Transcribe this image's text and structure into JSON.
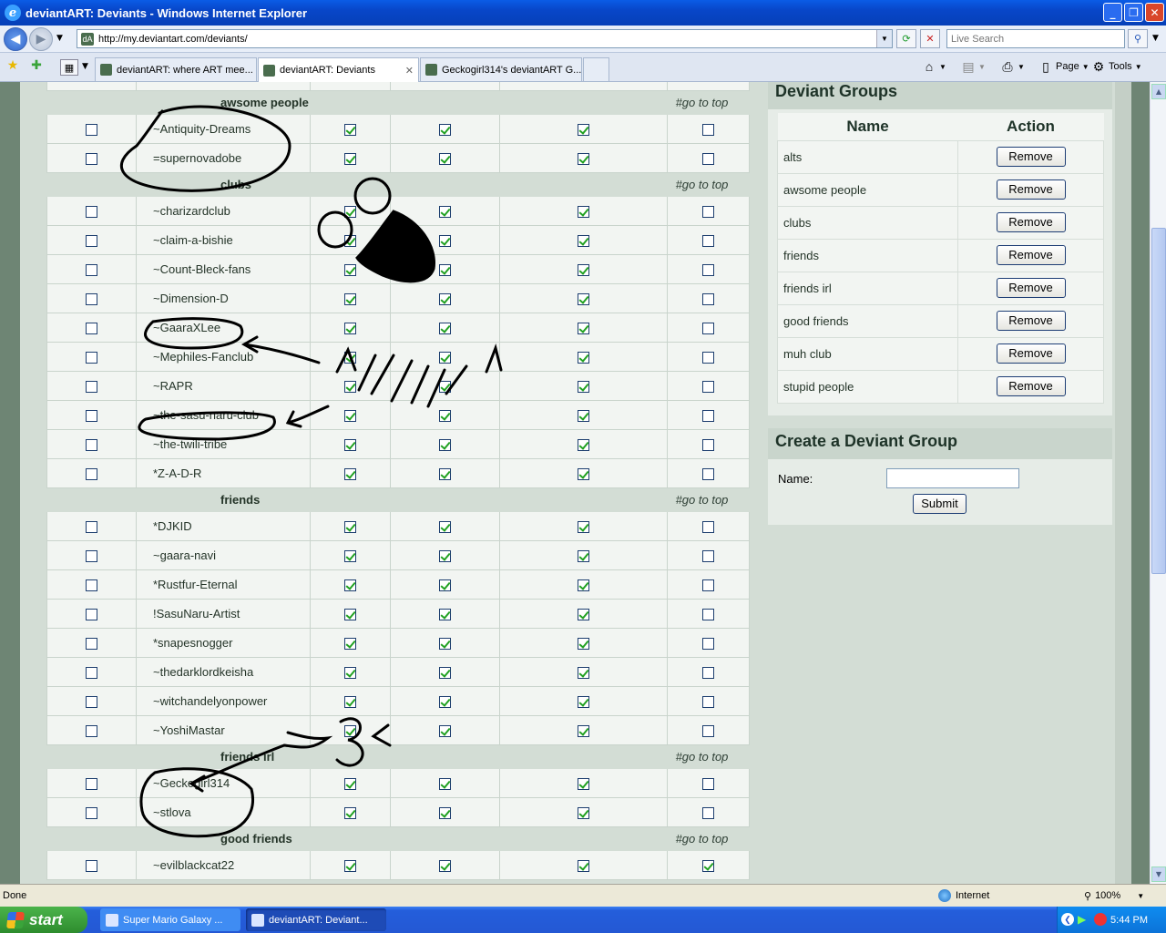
{
  "window": {
    "title": "deviantART: Deviants - Windows Internet Explorer"
  },
  "nav": {
    "url": "http://my.deviantart.com/deviants/",
    "search_placeholder": "Live Search"
  },
  "tabs": [
    {
      "label": "deviantART: where ART mee...",
      "active": false
    },
    {
      "label": "deviantART: Deviants",
      "active": true
    },
    {
      "label": "Geckogirl314's deviantART G...",
      "active": false
    }
  ],
  "toolbar": {
    "page": "Page",
    "tools": "Tools"
  },
  "go_to_top": "#go to top",
  "deviant_groups": [
    {
      "group": "awsome people",
      "members": [
        {
          "name": "~Antiquity-Dreams",
          "checks": [
            true,
            true,
            true,
            false
          ]
        },
        {
          "name": "=supernovadobe",
          "checks": [
            true,
            true,
            true,
            false
          ]
        }
      ]
    },
    {
      "group": "clubs",
      "members": [
        {
          "name": "~charizardclub",
          "checks": [
            true,
            true,
            true,
            false
          ]
        },
        {
          "name": "~claim-a-bishie",
          "checks": [
            true,
            true,
            true,
            false
          ]
        },
        {
          "name": "~Count-Bleck-fans",
          "checks": [
            true,
            true,
            true,
            false
          ]
        },
        {
          "name": "~Dimension-D",
          "checks": [
            true,
            true,
            true,
            false
          ]
        },
        {
          "name": "~GaaraXLee",
          "checks": [
            true,
            true,
            true,
            false
          ]
        },
        {
          "name": "~Mephiles-Fanclub",
          "checks": [
            true,
            true,
            true,
            false
          ]
        },
        {
          "name": "~RAPR",
          "checks": [
            true,
            true,
            true,
            false
          ]
        },
        {
          "name": "~the-sasu-naru-club",
          "checks": [
            true,
            true,
            true,
            false
          ]
        },
        {
          "name": "~the-twili-tribe",
          "checks": [
            true,
            true,
            true,
            false
          ]
        },
        {
          "name": "*Z-A-D-R",
          "checks": [
            true,
            true,
            true,
            false
          ]
        }
      ]
    },
    {
      "group": "friends",
      "members": [
        {
          "name": "*DJKID",
          "checks": [
            true,
            true,
            true,
            false
          ]
        },
        {
          "name": "~gaara-navi",
          "checks": [
            true,
            true,
            true,
            false
          ]
        },
        {
          "name": "*Rustfur-Eternal",
          "checks": [
            true,
            true,
            true,
            false
          ]
        },
        {
          "name": "!SasuNaru-Artist",
          "checks": [
            true,
            true,
            true,
            false
          ]
        },
        {
          "name": "*snapesnogger",
          "checks": [
            true,
            true,
            true,
            false
          ]
        },
        {
          "name": "~thedarklordkeisha",
          "checks": [
            true,
            true,
            true,
            false
          ]
        },
        {
          "name": "~witchandelyonpower",
          "checks": [
            true,
            true,
            true,
            false
          ]
        },
        {
          "name": "~YoshiMastar",
          "checks": [
            true,
            true,
            true,
            false
          ]
        }
      ]
    },
    {
      "group": "friends irl",
      "members": [
        {
          "name": "~Geckogirl314",
          "checks": [
            true,
            true,
            true,
            false
          ]
        },
        {
          "name": "~stlova",
          "checks": [
            true,
            true,
            true,
            false
          ]
        }
      ]
    },
    {
      "group": "good friends",
      "members": [
        {
          "name": "~evilblackcat22",
          "checks": [
            true,
            true,
            true,
            true
          ]
        }
      ]
    }
  ],
  "sidebar": {
    "groups_title": "Deviant Groups",
    "col_name": "Name",
    "col_action": "Action",
    "remove_label": "Remove",
    "groups": [
      "alts",
      "awsome people",
      "clubs",
      "friends",
      "friends irl",
      "good friends",
      "muh club",
      "stupid people"
    ],
    "create_title": "Create a Deviant Group",
    "name_label": "Name:",
    "submit_label": "Submit"
  },
  "status": {
    "left": "Done",
    "zone": "Internet",
    "zoom": "100%"
  },
  "taskbar": {
    "start": "start",
    "tasks": [
      {
        "label": "Super Mario Galaxy ...",
        "active": false
      },
      {
        "label": "deviantART: Deviant...",
        "active": true
      }
    ],
    "clock": "5:44 PM"
  }
}
